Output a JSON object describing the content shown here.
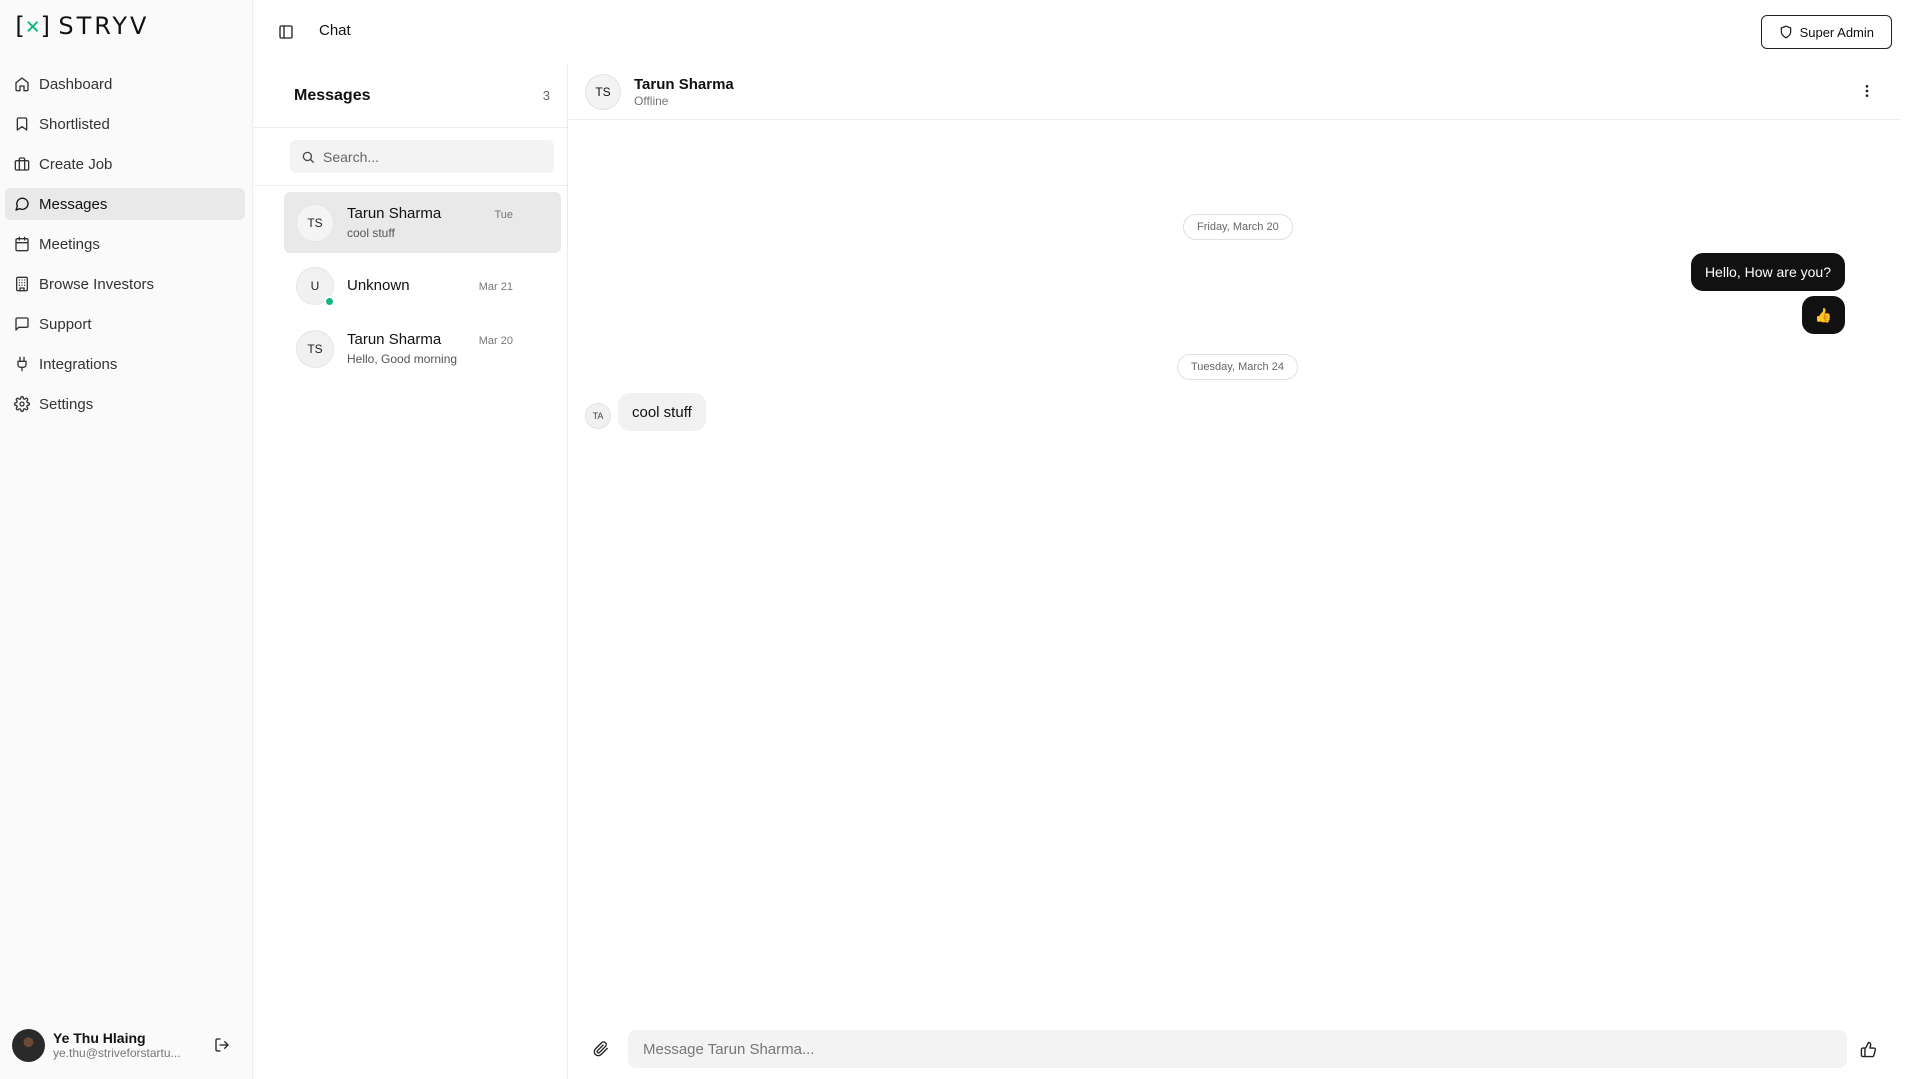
{
  "brand": {
    "logo_mark_left": "[",
    "logo_mark_x": "×",
    "logo_mark_right": "]",
    "logo_text": "STRYV",
    "accent": "#10b981"
  },
  "sidebar": {
    "items": [
      {
        "label": "Dashboard",
        "icon": "home-icon",
        "active": false
      },
      {
        "label": "Shortlisted",
        "icon": "bookmark-icon",
        "active": false
      },
      {
        "label": "Create Job",
        "icon": "briefcase-icon",
        "active": false
      },
      {
        "label": "Messages",
        "icon": "message-circle-icon",
        "active": true
      },
      {
        "label": "Meetings",
        "icon": "calendar-icon",
        "active": false
      },
      {
        "label": "Browse Investors",
        "icon": "building-icon",
        "active": false
      },
      {
        "label": "Support",
        "icon": "message-square-icon",
        "active": false
      },
      {
        "label": "Integrations",
        "icon": "plug-icon",
        "active": false
      },
      {
        "label": "Settings",
        "icon": "gear-icon",
        "active": false
      }
    ],
    "user": {
      "name": "Ye Thu Hlaing",
      "email": "ye.thu@striveforstartu..."
    }
  },
  "topbar": {
    "title": "Chat",
    "admin_label": "Super Admin"
  },
  "messages_list": {
    "title": "Messages",
    "count": "3",
    "search_placeholder": "Search...",
    "conversations": [
      {
        "initials": "TS",
        "name": "Tarun Sharma",
        "date": "Tue",
        "preview": "cool stuff",
        "active": true,
        "online": false
      },
      {
        "initials": "U",
        "name": "Unknown",
        "date": "Mar 21",
        "preview": "",
        "active": false,
        "online": true
      },
      {
        "initials": "TS",
        "name": "Tarun Sharma",
        "date": "Mar 20",
        "preview": "Hello, Good morning",
        "active": false,
        "online": false
      }
    ]
  },
  "chat": {
    "contact": {
      "initials": "TS",
      "name": "Tarun Sharma",
      "status": "Offline"
    },
    "date1": "Friday, March 20",
    "date2": "Tuesday, March 24",
    "out_msg1": "Hello, How are you?",
    "out_msg2": "👍",
    "in_avatar": "TA",
    "in_msg1": "cool stuff",
    "composer_placeholder": "Message Tarun Sharma..."
  }
}
